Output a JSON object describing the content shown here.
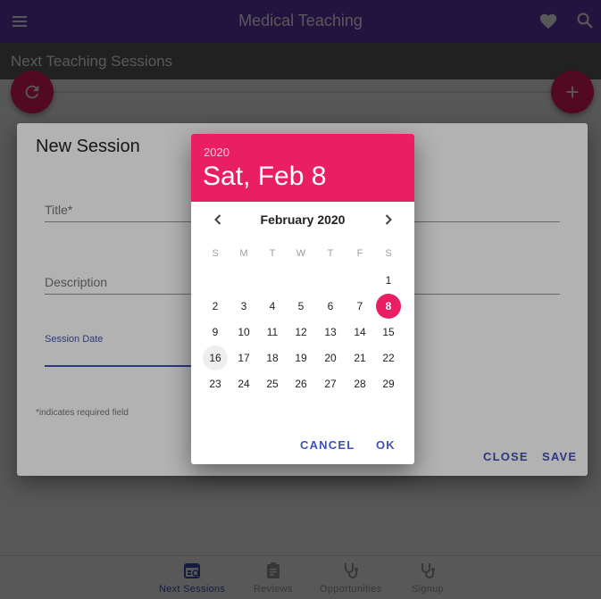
{
  "app": {
    "title": "Medical Teaching"
  },
  "subbar": {
    "title": "Next Teaching Sessions"
  },
  "colors": {
    "primary": "#673ab7",
    "accent": "#e91e63",
    "active": "#3f51b5"
  },
  "icons": {
    "menu": "menu-icon",
    "favorite": "heart-icon",
    "search": "search-icon",
    "refresh": "refresh-icon",
    "add": "plus-icon"
  },
  "fab": {
    "add_label": "+"
  },
  "bottom_nav": {
    "items": [
      {
        "label": "Next Sessions",
        "icon": "calendar-list-icon",
        "active": true
      },
      {
        "label": "Reviews",
        "icon": "clipboard-icon",
        "active": false
      },
      {
        "label": "Opportunities",
        "icon": "stethoscope-icon",
        "active": false
      },
      {
        "label": "Signup",
        "icon": "stethoscope-icon",
        "active": false
      }
    ]
  },
  "dialog": {
    "title": "New Session",
    "fields": {
      "title_label": "Title*",
      "description_label": "Description",
      "session_date_label": "Session Date"
    },
    "required_note": "*indicates required field",
    "close_label": "CLOSE",
    "save_label": "SAVE"
  },
  "datepicker": {
    "year": "2020",
    "selected_date": "Sat, Feb 8",
    "month_label": "February 2020",
    "weekdays": [
      "S",
      "M",
      "T",
      "W",
      "T",
      "F",
      "S"
    ],
    "first_weekday_index": 6,
    "days_in_month": 29,
    "selected_day": 8,
    "today_day": 16,
    "cancel_label": "CANCEL",
    "ok_label": "OK"
  }
}
